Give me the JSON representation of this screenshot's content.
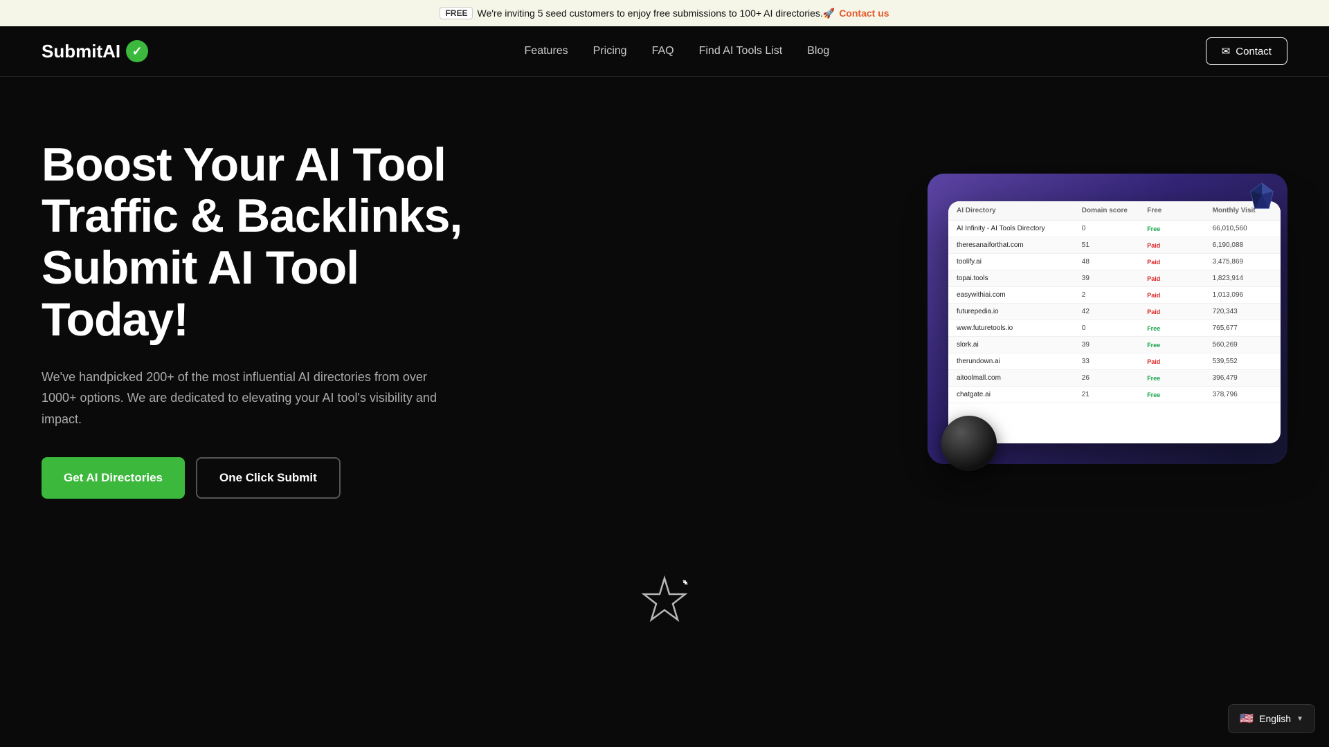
{
  "banner": {
    "free_badge": "FREE",
    "text": "We're inviting 5 seed customers to enjoy free submissions to 100+ AI directories.🚀",
    "contact_text": "Contact us"
  },
  "navbar": {
    "logo_text": "SubmitAI",
    "nav_links": [
      {
        "label": "Features",
        "href": "#"
      },
      {
        "label": "Pricing",
        "href": "#"
      },
      {
        "label": "FAQ",
        "href": "#"
      },
      {
        "label": "Find AI Tools List",
        "href": "#"
      },
      {
        "label": "Blog",
        "href": "#"
      }
    ],
    "contact_button": "Contact"
  },
  "hero": {
    "heading_line1": "Boost Your AI Tool",
    "heading_line2": "Traffic & Backlinks,",
    "heading_line3": "Submit AI Tool",
    "heading_line4": "Today!",
    "description": "We've handpicked 200+ of the most influential AI directories from over 1000+ options. We are dedicated to elevating your AI tool's visibility and impact.",
    "btn_primary": "Get AI Directories",
    "btn_secondary": "One Click Submit"
  },
  "table": {
    "headers": [
      "AI Directory",
      "Domain score",
      "Free",
      "Monthly Visit"
    ],
    "rows": [
      {
        "name": "AI Infinity - AI Tools Directory",
        "score": "0",
        "type": "Free",
        "visits": "66,010,560"
      },
      {
        "name": "theresanaiforthat.com",
        "score": "51",
        "type": "Paid",
        "visits": "6,190,088"
      },
      {
        "name": "toolify.ai",
        "score": "48",
        "type": "Paid",
        "visits": "3,475,869"
      },
      {
        "name": "topai.tools",
        "score": "39",
        "type": "Paid",
        "visits": "1,823,914"
      },
      {
        "name": "easywithiai.com",
        "score": "2",
        "type": "Paid",
        "visits": "1,013,096"
      },
      {
        "name": "futurepedia.io",
        "score": "42",
        "type": "Paid",
        "visits": "720,343"
      },
      {
        "name": "www.futuretools.io",
        "score": "0",
        "type": "Free",
        "visits": "765,677"
      },
      {
        "name": "slork.ai",
        "score": "39",
        "type": "Free",
        "visits": "560,269"
      },
      {
        "name": "therundown.ai",
        "score": "33",
        "type": "Paid",
        "visits": "539,552"
      },
      {
        "name": "aitoolmall.com",
        "score": "26",
        "type": "Free",
        "visits": "396,479"
      },
      {
        "name": "chatgate.ai",
        "score": "21",
        "type": "Free",
        "visits": "378,796"
      }
    ]
  },
  "language": {
    "flag": "🇺🇸",
    "label": "English"
  }
}
